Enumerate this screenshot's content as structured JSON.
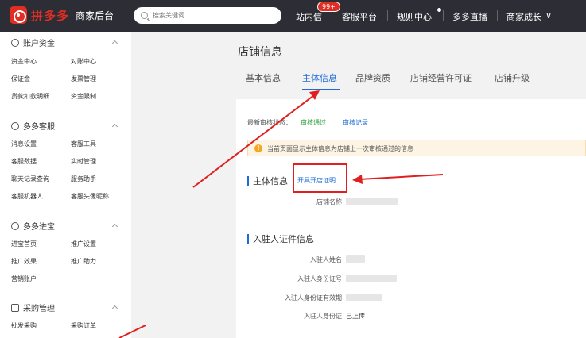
{
  "header": {
    "logo_text": "拼多多",
    "logo_sub": "商家后台",
    "search_placeholder": "搜索关键词",
    "nav": [
      "站内信",
      "客服平台",
      "规则中心",
      "多多直播",
      "商家成长"
    ],
    "message_badge": "99+",
    "dropdown_glyph": "∨"
  },
  "sidebar": {
    "sections": [
      {
        "title": "账户资金",
        "icon": "wallet-icon",
        "items": [
          "资金中心",
          "对账中心",
          "保证金",
          "发票管理",
          "货款扣款明细",
          "资金限制"
        ]
      },
      {
        "title": "多多客服",
        "icon": "headset-icon",
        "items": [
          "消息设置",
          "客服工具",
          "客服数据",
          "实时管理",
          "聊天记录查询",
          "服务助手",
          "客服机器人",
          "客服头像昵称"
        ]
      },
      {
        "title": "多多进宝",
        "icon": "promotion-icon",
        "items": [
          "进宝首页",
          "推广设置",
          "推广效果",
          "推广助力",
          "营销账户"
        ]
      },
      {
        "title": "采购管理",
        "icon": "purchase-icon",
        "items": [
          "批发采购",
          "采购订单"
        ]
      }
    ]
  },
  "main": {
    "page_title": "店铺信息",
    "tabs": [
      "基本信息",
      "主体信息",
      "品牌资质",
      "店铺经营许可证",
      "店铺升级"
    ],
    "audit": {
      "label": "最新审核状态：",
      "status": "审核通过",
      "record_link": "审核记录"
    },
    "notice": "当前页面显示主体信息为店铺上一次审核通过的信息",
    "entity_section": {
      "title": "主体信息",
      "link": "开具开店证明",
      "fields": [
        {
          "label": "店铺名称"
        }
      ]
    },
    "cert_section": {
      "title": "入驻人证件信息",
      "fields": [
        {
          "label": "入驻人姓名"
        },
        {
          "label": "入驻人身份证号"
        },
        {
          "label": "入驻人身份证有效期"
        },
        {
          "label": "入驻人身份证",
          "value": "已上传"
        }
      ]
    }
  },
  "colors": {
    "brand": "#e02e24",
    "topbar": "#2d2d35",
    "link": "#1e6bd6",
    "success": "#2f9e44",
    "annotation": "#e02020"
  }
}
